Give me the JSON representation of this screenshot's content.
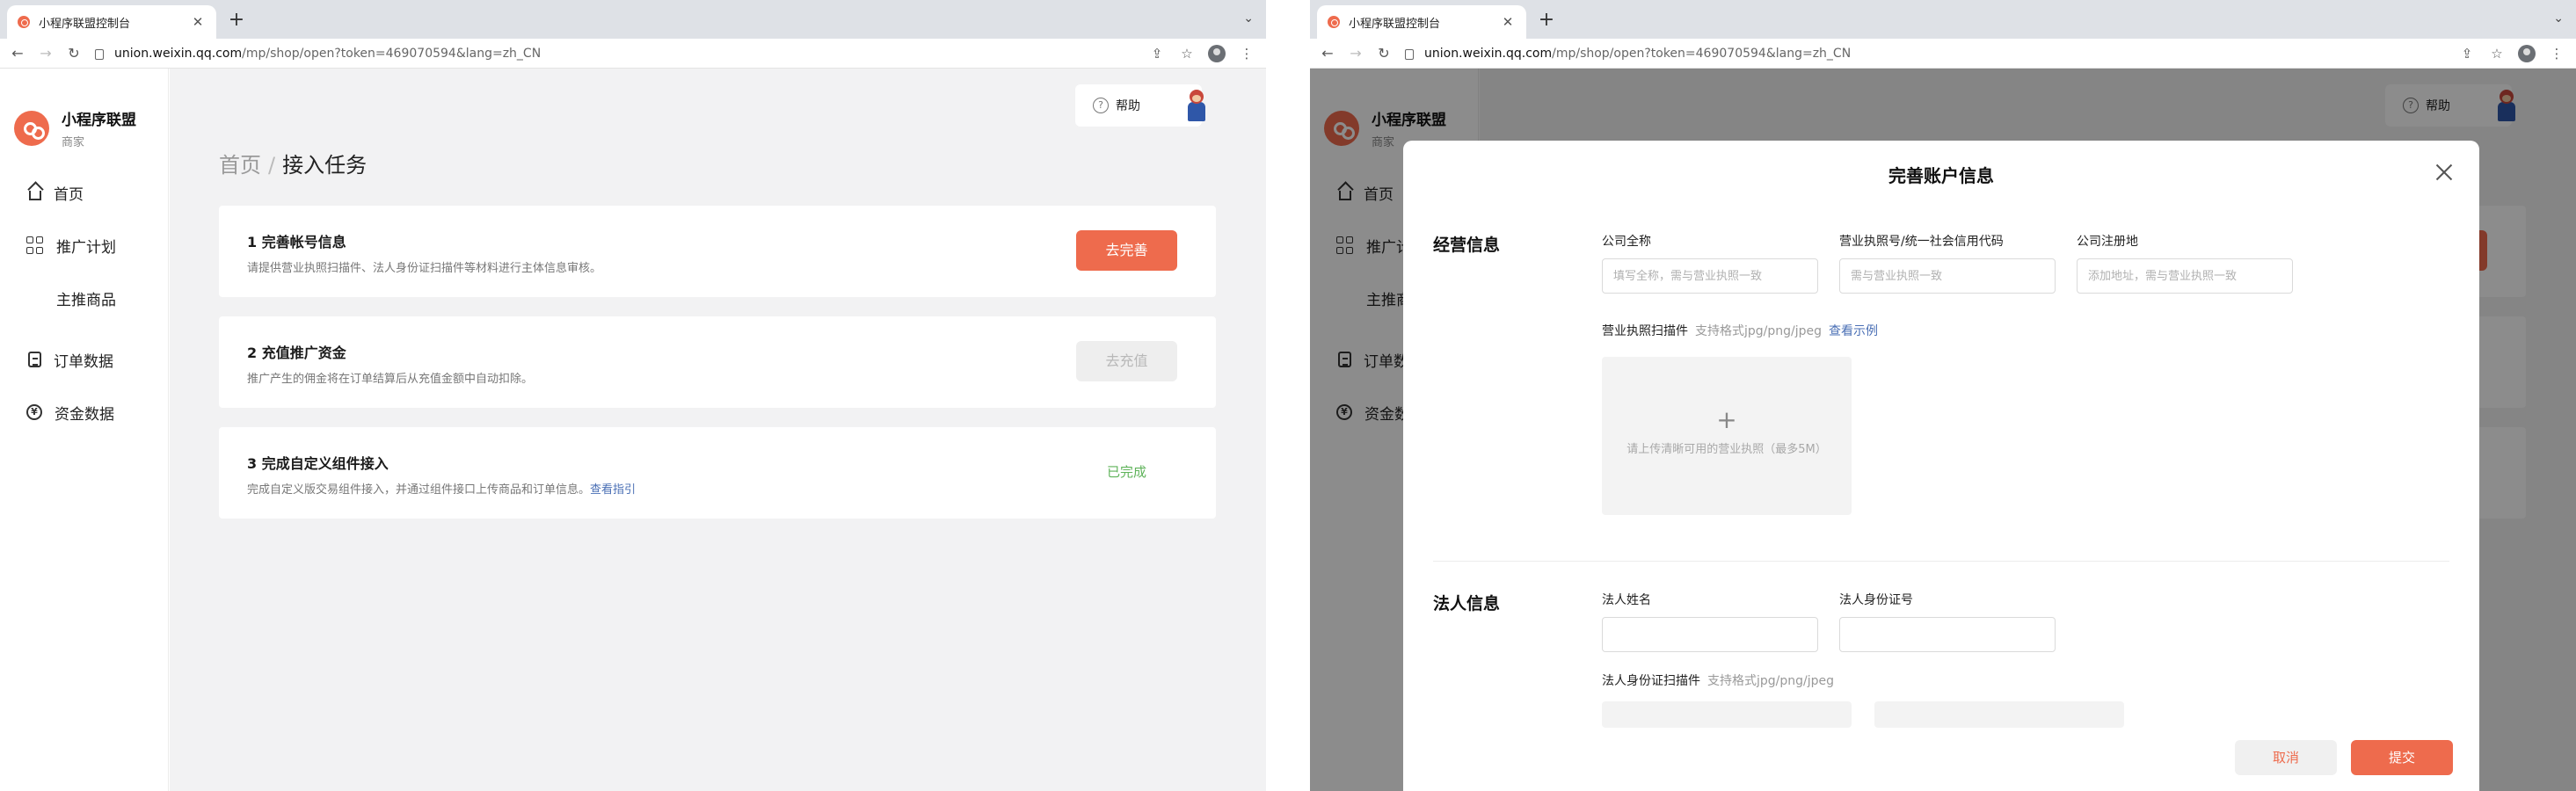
{
  "browser": {
    "tab_title": "小程序联盟控制台",
    "url_host": "union.weixin.qq.com",
    "url_path": "/mp/shop/open?token=469070594&lang=zh_CN"
  },
  "sidebar": {
    "brand_name": "小程序联盟",
    "brand_sub": "商家",
    "items": [
      {
        "label": "首页",
        "icon": "home-icon"
      },
      {
        "label": "推广计划",
        "icon": "grid-icon"
      },
      {
        "label": "主推商品",
        "icon": ""
      },
      {
        "label": "订单数据",
        "icon": "clipboard-icon"
      },
      {
        "label": "资金数据",
        "icon": "yen-icon"
      }
    ]
  },
  "header": {
    "help_label": "帮助"
  },
  "breadcrumb": {
    "home": "首页",
    "separator": "/",
    "current": "接入任务"
  },
  "tasks": [
    {
      "title": "1  完善帐号信息",
      "desc": "请提供营业执照扫描件、法人身份证扫描件等材料进行主体信息审核。",
      "action": "去完善",
      "state": "primary"
    },
    {
      "title": "2  充值推广资金",
      "desc": "推广产生的佣金将在订单结算后从充值金额中自动扣除。",
      "action": "去充值",
      "state": "disabled"
    },
    {
      "title": "3  完成自定义组件接入",
      "desc": "完成自定义版交易组件接入，并通过组件接口上传商品和订单信息。",
      "desc_link": "查看指引",
      "action": "已完成",
      "state": "done"
    }
  ],
  "modal": {
    "title": "完善账户信息",
    "business_section": "经营信息",
    "company_name_label": "公司全称",
    "company_name_placeholder": "填写全称，需与营业执照一致",
    "license_no_label": "营业执照号/统一社会信用代码",
    "license_no_placeholder": "需与营业执照一致",
    "address_label": "公司注册地",
    "address_placeholder": "添加地址，需与营业执照一致",
    "license_scan_label": "营业执照扫描件",
    "license_scan_hint": "支持格式jpg/png/jpeg",
    "license_scan_link": "查看示例",
    "upload_plus": "+",
    "upload_text": "请上传清晰可用的营业执照（最多5M）",
    "legal_section": "法人信息",
    "legal_name_label": "法人姓名",
    "legal_id_label": "法人身份证号",
    "id_scan_label": "法人身份证扫描件",
    "id_scan_hint": "支持格式jpg/png/jpeg",
    "cancel_label": "取消",
    "submit_label": "提交"
  },
  "colors": {
    "accent": "#ee6b4d",
    "success": "#5fb35a",
    "link": "#4a6fb5"
  }
}
